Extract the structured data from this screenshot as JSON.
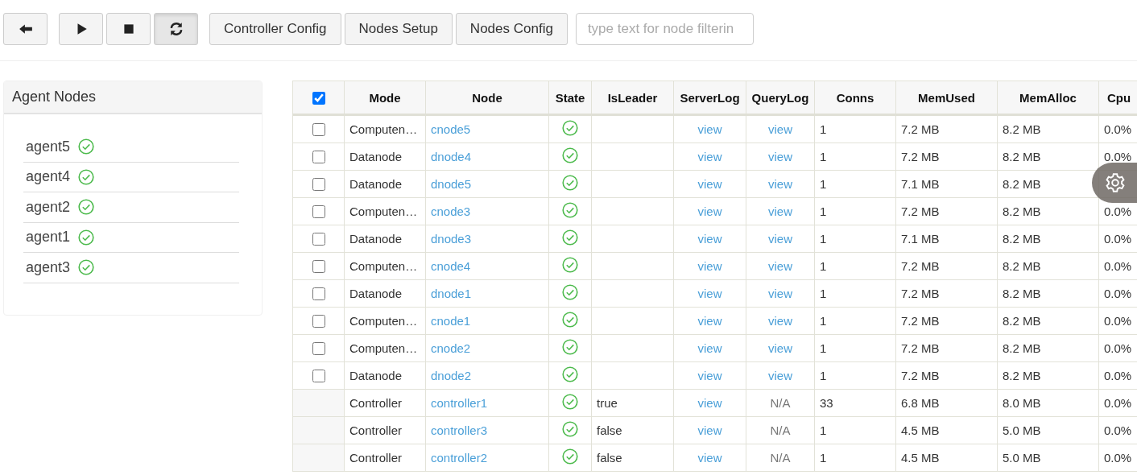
{
  "toolbar": {
    "icon_buttons": [
      {
        "kind": "back",
        "pressed": false
      },
      {
        "kind": "play",
        "pressed": false
      },
      {
        "kind": "stop",
        "pressed": false
      },
      {
        "kind": "refresh",
        "pressed": true
      }
    ],
    "text_buttons": [
      "Controller Config",
      "Nodes Setup",
      "Nodes Config"
    ],
    "filter": {
      "placeholder": "type text for node filterin"
    }
  },
  "agent_panel": {
    "title": "Agent Nodes",
    "items": [
      {
        "name": "agent5",
        "healthy": true
      },
      {
        "name": "agent4",
        "healthy": true
      },
      {
        "name": "agent2",
        "healthy": true
      },
      {
        "name": "agent1",
        "healthy": true
      },
      {
        "name": "agent3",
        "healthy": true
      }
    ]
  },
  "table": {
    "select_all": {
      "checked": true
    },
    "columns": [
      "Mode",
      "Node",
      "State",
      "IsLeader",
      "ServerLog",
      "QueryLog",
      "Conns",
      "MemUsed",
      "MemAlloc",
      "Cpu"
    ],
    "rows": [
      {
        "kind": "node",
        "checked": false,
        "mode": "Computen…",
        "node": "cnode5",
        "healthy": true,
        "is_leader": "",
        "server_log": "view",
        "query_log": "view",
        "conns": "1",
        "mem_used": "7.2 MB",
        "mem_alloc": "8.2 MB",
        "cpu": "0.0%"
      },
      {
        "kind": "node",
        "checked": false,
        "mode": "Datanode",
        "node": "dnode4",
        "healthy": true,
        "is_leader": "",
        "server_log": "view",
        "query_log": "view",
        "conns": "1",
        "mem_used": "7.2 MB",
        "mem_alloc": "8.2 MB",
        "cpu": "0.0%"
      },
      {
        "kind": "node",
        "checked": false,
        "mode": "Datanode",
        "node": "dnode5",
        "healthy": true,
        "is_leader": "",
        "server_log": "view",
        "query_log": "view",
        "conns": "1",
        "mem_used": "7.1 MB",
        "mem_alloc": "8.2 MB"
      },
      {
        "kind": "node",
        "checked": false,
        "mode": "Computen…",
        "node": "cnode3",
        "healthy": true,
        "is_leader": "",
        "server_log": "view",
        "query_log": "view",
        "conns": "1",
        "mem_used": "7.2 MB",
        "mem_alloc": "8.2 MB",
        "cpu": "0.0%"
      },
      {
        "kind": "node",
        "checked": false,
        "mode": "Datanode",
        "node": "dnode3",
        "healthy": true,
        "is_leader": "",
        "server_log": "view",
        "query_log": "view",
        "conns": "1",
        "mem_used": "7.1 MB",
        "mem_alloc": "8.2 MB",
        "cpu": "0.0%"
      },
      {
        "kind": "node",
        "checked": false,
        "mode": "Computen…",
        "node": "cnode4",
        "healthy": true,
        "is_leader": "",
        "server_log": "view",
        "query_log": "view",
        "conns": "1",
        "mem_used": "7.2 MB",
        "mem_alloc": "8.2 MB",
        "cpu": "0.0%"
      },
      {
        "kind": "node",
        "checked": false,
        "mode": "Datanode",
        "node": "dnode1",
        "healthy": true,
        "is_leader": "",
        "server_log": "view",
        "query_log": "view",
        "conns": "1",
        "mem_used": "7.2 MB",
        "mem_alloc": "8.2 MB",
        "cpu": "0.0%"
      },
      {
        "kind": "node",
        "checked": false,
        "mode": "Computen…",
        "node": "cnode1",
        "healthy": true,
        "is_leader": "",
        "server_log": "view",
        "query_log": "view",
        "conns": "1",
        "mem_used": "7.2 MB",
        "mem_alloc": "8.2 MB",
        "cpu": "0.0%"
      },
      {
        "kind": "node",
        "checked": false,
        "mode": "Computen…",
        "node": "cnode2",
        "healthy": true,
        "is_leader": "",
        "server_log": "view",
        "query_log": "view",
        "conns": "1",
        "mem_used": "7.2 MB",
        "mem_alloc": "8.2 MB",
        "cpu": "0.0%"
      },
      {
        "kind": "node",
        "checked": false,
        "mode": "Datanode",
        "node": "dnode2",
        "healthy": true,
        "is_leader": "",
        "server_log": "view",
        "query_log": "view",
        "conns": "1",
        "mem_used": "7.2 MB",
        "mem_alloc": "8.2 MB",
        "cpu": "0.0%"
      },
      {
        "kind": "controller",
        "mode": "Controller",
        "node": "controller1",
        "healthy": true,
        "is_leader": "true",
        "server_log": "view",
        "query_log": "N/A",
        "conns": "33",
        "mem_used": "6.8 MB",
        "mem_alloc": "8.0 MB",
        "cpu": "0.0%"
      },
      {
        "kind": "controller",
        "mode": "Controller",
        "node": "controller3",
        "healthy": true,
        "is_leader": "false",
        "server_log": "view",
        "query_log": "N/A",
        "conns": "1",
        "mem_used": "4.5 MB",
        "mem_alloc": "5.0 MB",
        "cpu": "0.0%"
      },
      {
        "kind": "controller",
        "mode": "Controller",
        "node": "controller2",
        "healthy": true,
        "is_leader": "false",
        "server_log": "view",
        "query_log": "N/A",
        "conns": "1",
        "mem_used": "4.5 MB",
        "mem_alloc": "5.0 MB",
        "cpu": "0.0%"
      }
    ]
  },
  "settings_fab": {
    "kind": "gear"
  }
}
